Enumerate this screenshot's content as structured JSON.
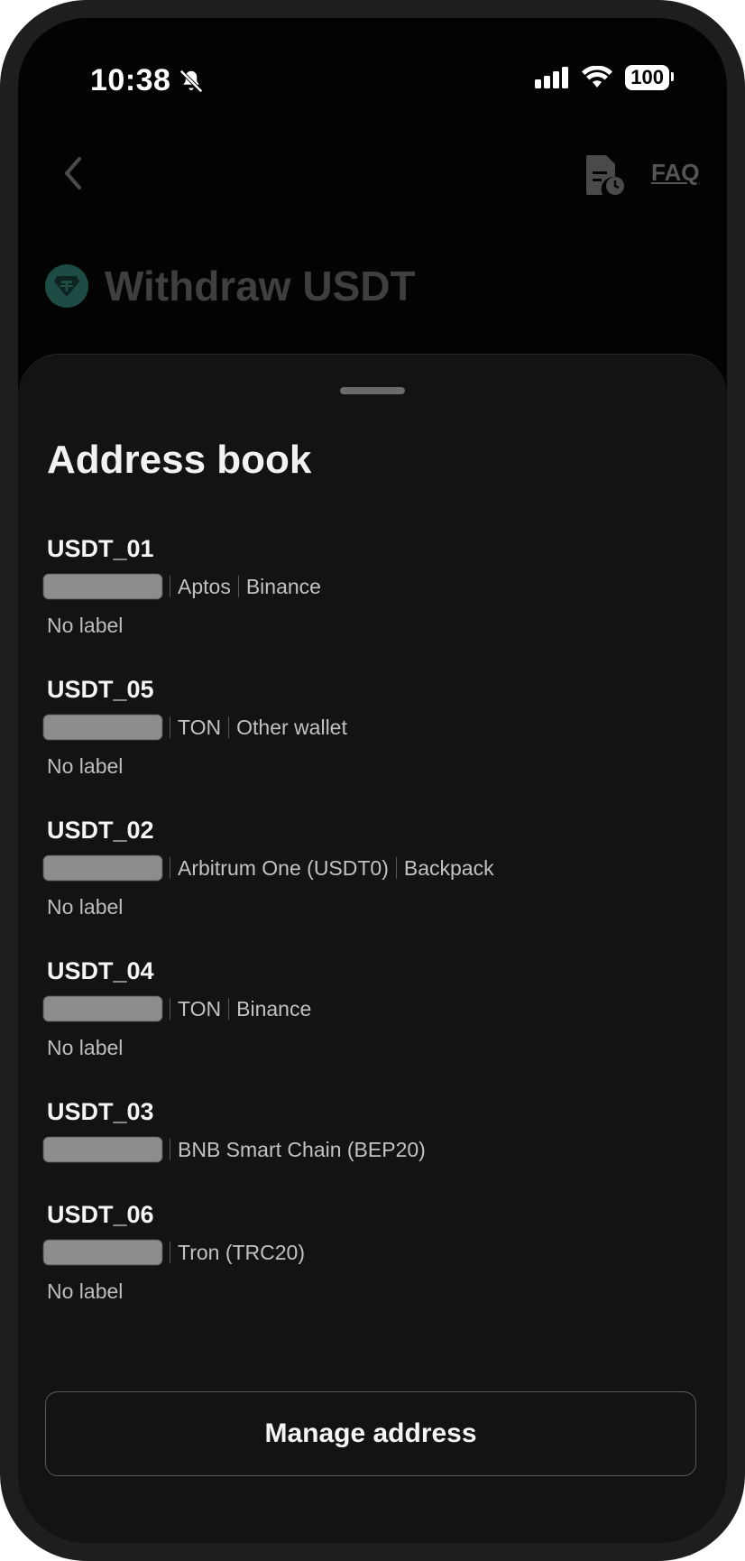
{
  "status_bar": {
    "time": "10:38",
    "battery": "100"
  },
  "header": {
    "faq_label": "FAQ",
    "title": "Withdraw USDT"
  },
  "sheet": {
    "title": "Address book",
    "entries": [
      {
        "name": "USDT_01",
        "network": "Aptos",
        "wallet": "Binance",
        "label": "No label"
      },
      {
        "name": "USDT_05",
        "network": "TON",
        "wallet": "Other wallet",
        "label": "No label"
      },
      {
        "name": "USDT_02",
        "network": "Arbitrum One (USDT0)",
        "wallet": "Backpack",
        "label": "No label"
      },
      {
        "name": "USDT_04",
        "network": "TON",
        "wallet": "Binance",
        "label": "No label"
      },
      {
        "name": "USDT_03",
        "network": "BNB Smart Chain (BEP20)"
      },
      {
        "name": "USDT_06",
        "network": "Tron (TRC20)",
        "label": "No label"
      }
    ],
    "manage_label": "Manage address"
  },
  "colors": {
    "sheet_bg": "#131313",
    "screen_bg": "#030303",
    "usdt_green": "#1c4c43"
  },
  "icons": [
    "bell-slash-icon",
    "cellular-signal-icon",
    "wifi-icon",
    "battery-icon",
    "chevron-left-icon",
    "document-history-icon",
    "usdt-logo-icon"
  ]
}
